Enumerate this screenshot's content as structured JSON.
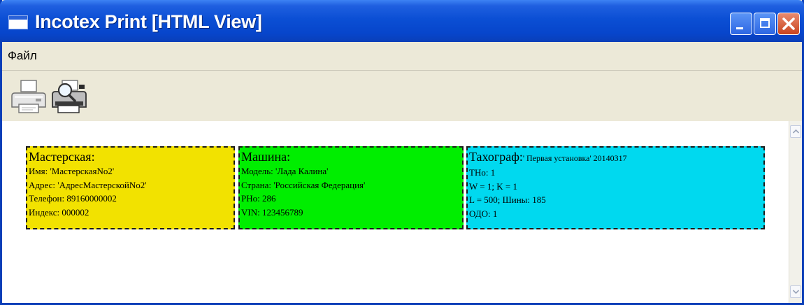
{
  "window": {
    "title": "Incotex Print [HTML View]"
  },
  "menu": {
    "items": [
      "Файл"
    ]
  },
  "toolbar": {
    "print_icon": "printer-icon",
    "preview_icon": "print-preview-icon"
  },
  "workshop": {
    "header": "Мастерская:",
    "lines": [
      "Имя: 'МастерскаяNo2'",
      "Адрес: 'АдресМастерскойNo2'",
      "Телефон: 89160000002",
      "Индекс: 000002"
    ]
  },
  "car": {
    "header": "Машина:",
    "lines": [
      "Модель: 'Лада Калина'",
      "Страна: 'Российская Федерация'",
      "PHo: 286",
      "VIN: 123456789"
    ]
  },
  "tacho": {
    "header": "Тахограф:",
    "header_sub": "' Первая установка' 20140317",
    "lines": [
      "THo: 1",
      "W = 1; K = 1",
      "L = 500; Шины: 185",
      "ОДО: 1"
    ]
  },
  "colors": {
    "workshop_bg": "#f2e200",
    "car_bg": "#00ee00",
    "tacho_bg": "#00d9ef",
    "titlebar": "#0b4fd4"
  }
}
